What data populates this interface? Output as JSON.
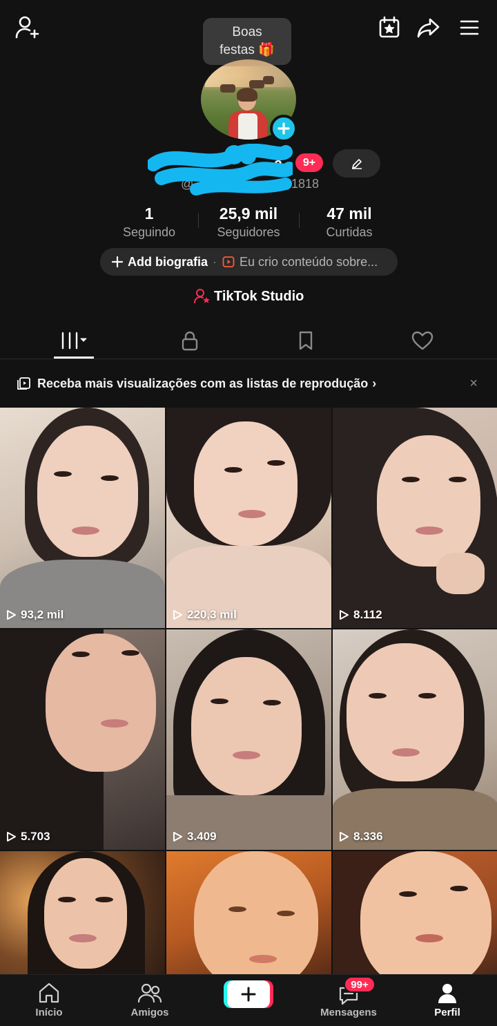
{
  "tooltip": {
    "line1": "Boas",
    "line2": "festas 🎁"
  },
  "profile": {
    "name_visible_tail": "a",
    "handle_prefix": "@",
    "handle_suffix": "1818",
    "notification_badge": "9+"
  },
  "stats": [
    {
      "value": "1",
      "label": "Seguindo"
    },
    {
      "value": "25,9 mil",
      "label": "Seguidores"
    },
    {
      "value": "47 mil",
      "label": "Curtidas"
    }
  ],
  "bio": {
    "add_label": "Add biografia",
    "separator": "·",
    "creator_text": "Eu crio conteúdo sobre..."
  },
  "studio": {
    "label": "TikTok Studio"
  },
  "banner": {
    "text": "Receba mais visualizações com as listas de reprodução",
    "chevron": "›",
    "close": "×"
  },
  "videos": [
    {
      "views": "93,2 mil"
    },
    {
      "views": "220,3 mil"
    },
    {
      "views": "8.112"
    },
    {
      "views": "5.703"
    },
    {
      "views": "3.409"
    },
    {
      "views": "8.336"
    },
    {
      "views": ""
    },
    {
      "views": ""
    },
    {
      "views": ""
    }
  ],
  "nav": {
    "home": "Início",
    "friends": "Amigos",
    "messages": "Mensagens",
    "messages_badge": "99+",
    "profile": "Perfil"
  },
  "colors": {
    "accent_red": "#fe2c55",
    "accent_cyan": "#25f4ee",
    "avatar_plus": "#20c4e8"
  }
}
